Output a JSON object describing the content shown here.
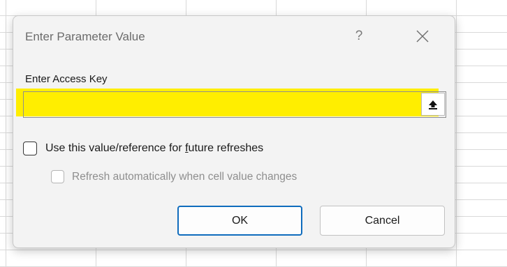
{
  "dialog": {
    "title": "Enter Parameter Value",
    "help_label": "?",
    "close_icon": "close-icon",
    "prompt_label": "Enter Access Key",
    "input_value": "",
    "input_highlight_color": "#ffee00",
    "collapse_icon": "collapse-dialog-icon",
    "use_value_checkbox": {
      "label_before": "Use this value/reference for ",
      "label_accel": "f",
      "label_after": "uture refreshes",
      "checked": false
    },
    "auto_refresh_checkbox": {
      "label": "Refresh automatically when cell value changes",
      "checked": false,
      "enabled": false
    },
    "ok_label": "OK",
    "cancel_label": "Cancel",
    "accent_color": "#0f6cbd"
  }
}
